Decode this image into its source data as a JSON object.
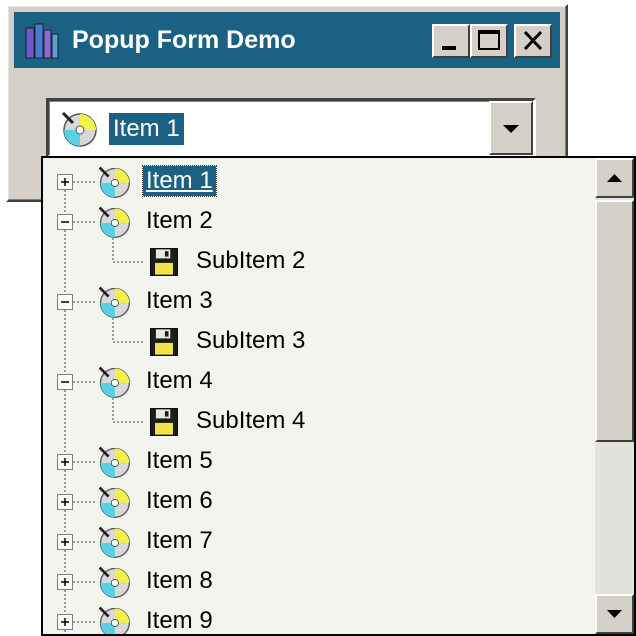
{
  "window": {
    "title": "Popup Form Demo"
  },
  "combo": {
    "selected_label": "Item 1",
    "icon": "cd-disc-icon"
  },
  "tree": {
    "items": [
      {
        "label": "Item 1",
        "icon": "cd-disc-icon",
        "expander": "plus",
        "selected": true
      },
      {
        "label": "Item 2",
        "icon": "cd-disc-icon",
        "expander": "minus"
      },
      {
        "label": "SubItem 2",
        "icon": "floppy-disk-icon",
        "level": 1
      },
      {
        "label": "Item 3",
        "icon": "cd-disc-icon",
        "expander": "minus"
      },
      {
        "label": "SubItem 3",
        "icon": "floppy-disk-icon",
        "level": 1
      },
      {
        "label": "Item 4",
        "icon": "cd-disc-icon",
        "expander": "minus"
      },
      {
        "label": "SubItem 4",
        "icon": "floppy-disk-icon",
        "level": 1
      },
      {
        "label": "Item 5",
        "icon": "cd-disc-icon",
        "expander": "plus"
      },
      {
        "label": "Item 6",
        "icon": "cd-disc-icon",
        "expander": "plus"
      },
      {
        "label": "Item 7",
        "icon": "cd-disc-icon",
        "expander": "plus"
      },
      {
        "label": "Item 8",
        "icon": "cd-disc-icon",
        "expander": "plus"
      },
      {
        "label": "Item 9",
        "icon": "cd-disc-icon",
        "expander": "plus"
      }
    ]
  },
  "colors": {
    "titlebar": "#1a6184",
    "selection": "#1a6184",
    "face": "#d4d0c8"
  }
}
